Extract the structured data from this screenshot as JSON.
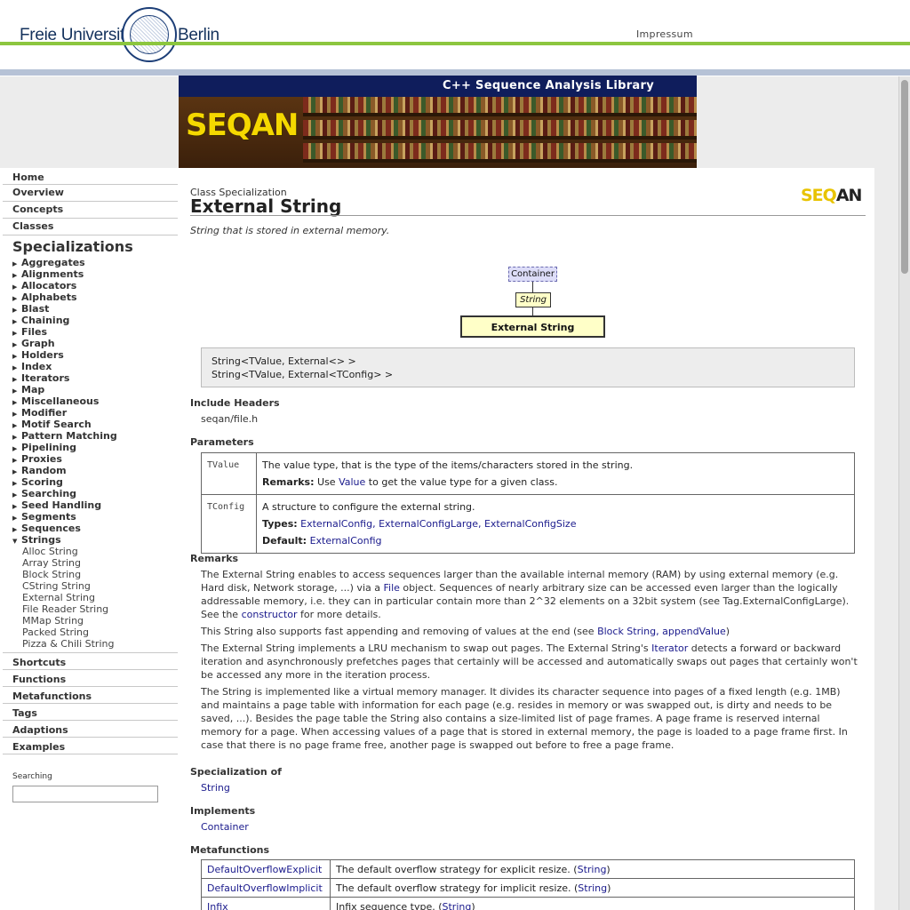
{
  "header": {
    "logo_left": "Freie Universität",
    "logo_right": "Berlin",
    "impressum": "Impressum"
  },
  "banner": {
    "title": "C++ Sequence Analysis Library",
    "logo": "SEQAN"
  },
  "sidebar": {
    "main_items_top": [
      "Home",
      "Overview",
      "Concepts",
      "Classes"
    ],
    "specializations_title": "Specializations",
    "categories": [
      "Aggregates",
      "Alignments",
      "Allocators",
      "Alphabets",
      "Blast",
      "Chaining",
      "Files",
      "Graph",
      "Holders",
      "Index",
      "Iterators",
      "Map",
      "Miscellaneous",
      "Modifier",
      "Motif Search",
      "Pattern Matching",
      "Pipelining",
      "Proxies",
      "Random",
      "Scoring",
      "Searching",
      "Seed Handling",
      "Segments",
      "Sequences",
      "Strings"
    ],
    "strings_children": [
      "Alloc String",
      "Array String",
      "Block String",
      "CString String",
      "External String",
      "File Reader String",
      "MMap String",
      "Packed String",
      "Pizza & Chili String"
    ],
    "main_items_bottom": [
      "Shortcuts",
      "Functions",
      "Metafunctions",
      "Tags",
      "Adaptions",
      "Examples"
    ],
    "search_label": "Searching",
    "search_value": ""
  },
  "page": {
    "kind": "Class Specialization",
    "title": "External String",
    "logo_seq": "SEQ",
    "logo_an": "AN",
    "summary": "String that is stored in external memory.",
    "diagram": {
      "container": "Container",
      "string": "String",
      "external": "External String"
    },
    "signatures": [
      "String<TValue, External<> >",
      "String<TValue, External<TConfig> >"
    ],
    "include_headers_title": "Include Headers",
    "include_header": "seqan/file.h",
    "parameters_title": "Parameters",
    "parameters": [
      {
        "name": "TValue",
        "description": "The value type, that is the type of the items/characters stored in the string.",
        "remarks_label": "Remarks:",
        "remarks_pre": "Use",
        "remarks_link": "Value",
        "remarks_post": "to get the value type for a given class."
      },
      {
        "name": "TConfig",
        "description": "A structure to configure the external string.",
        "types_label": "Types:",
        "types": "ExternalConfig, ExternalConfigLarge, ExternalConfigSize",
        "default_label": "Default:",
        "default": "ExternalConfig"
      }
    ],
    "remarks_title": "Remarks",
    "remarks": {
      "p1_a": "The External String enables to access sequences larger than the available internal memory (RAM) by using external memory (e.g. Hard disk, Network storage, ...) via a",
      "p1_link1": "File",
      "p1_b": "object. Sequences of nearly arbitrary size can be accessed even larger than the logically addressable memory, i.e. they can in particular contain more than 2^32 elements on a 32bit system (see Tag.ExternalConfigLarge). See the",
      "p1_link2": "constructor",
      "p1_c": "for more details.",
      "p2_a": "This String also supports fast appending and removing of values at the end (see",
      "p2_link": "Block String, appendValue",
      "p2_b": ")",
      "p3_a": "The External String implements a LRU mechanism to swap out pages. The External String's",
      "p3_link": "Iterator",
      "p3_b": "detects a forward or backward iteration and asynchronously prefetches pages that certainly will be accessed and automatically swaps out pages that certainly won't be accessed any more in the iteration process.",
      "p4": "The String is implemented like a virtual memory manager. It divides its character sequence into pages of a fixed length (e.g. 1MB) and maintains a page table with information for each page (e.g. resides in memory or was swapped out, is dirty and needs to be saved, ...). Besides the page table the String also contains a size-limited list of page frames. A page frame is reserved internal memory for a page. When accessing values of a page that is stored in external memory, the page is loaded to a page frame first. In case that there is no page frame free, another page is swapped out before to free a page frame."
    },
    "specialization_of_title": "Specialization of",
    "specialization_of": "String",
    "implements_title": "Implements",
    "implements": "Container",
    "metafunctions_title": "Metafunctions",
    "metafunctions": [
      {
        "name": "DefaultOverflowExplicit",
        "desc": "The default overflow strategy for explicit resize. (",
        "link": "String",
        "end": ")"
      },
      {
        "name": "DefaultOverflowImplicit",
        "desc": "The default overflow strategy for implicit resize. (",
        "link": "String",
        "end": ")"
      },
      {
        "name": "Infix",
        "desc": "Infix sequence type. (",
        "link": "String",
        "end": ")"
      }
    ]
  },
  "colors": {
    "fu_green": "#8cc63f",
    "fu_blue_line": "#b6c2d6",
    "banner_navy": "#0f1d5c",
    "link": "#1a1a8c",
    "seqan_yellow": "#f5d800"
  }
}
